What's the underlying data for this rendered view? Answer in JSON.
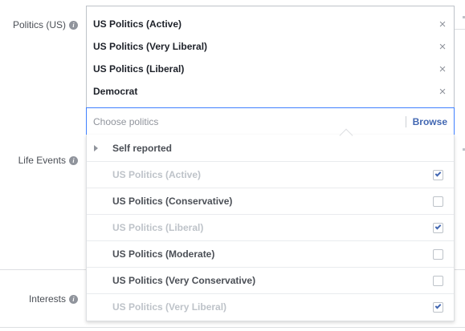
{
  "labels": {
    "politics": "Politics (US)",
    "life_events": "Life Events",
    "interests": "Interests"
  },
  "tokens": [
    "US Politics (Active)",
    "US Politics (Very Liberal)",
    "US Politics (Liberal)",
    "Democrat"
  ],
  "search": {
    "placeholder": "Choose politics",
    "browse_label": "Browse"
  },
  "dropdown": {
    "group_label": "Self reported",
    "options": [
      {
        "label": "US Politics (Active)",
        "checked": true
      },
      {
        "label": "US Politics (Conservative)",
        "checked": false
      },
      {
        "label": "US Politics (Liberal)",
        "checked": true
      },
      {
        "label": "US Politics (Moderate)",
        "checked": false
      },
      {
        "label": "US Politics (Very Conservative)",
        "checked": false
      },
      {
        "label": "US Politics (Very Liberal)",
        "checked": true
      }
    ]
  },
  "colors": {
    "accent": "#4267b2",
    "focus_border": "#4080ff",
    "disabled_text": "#bec3c9"
  }
}
